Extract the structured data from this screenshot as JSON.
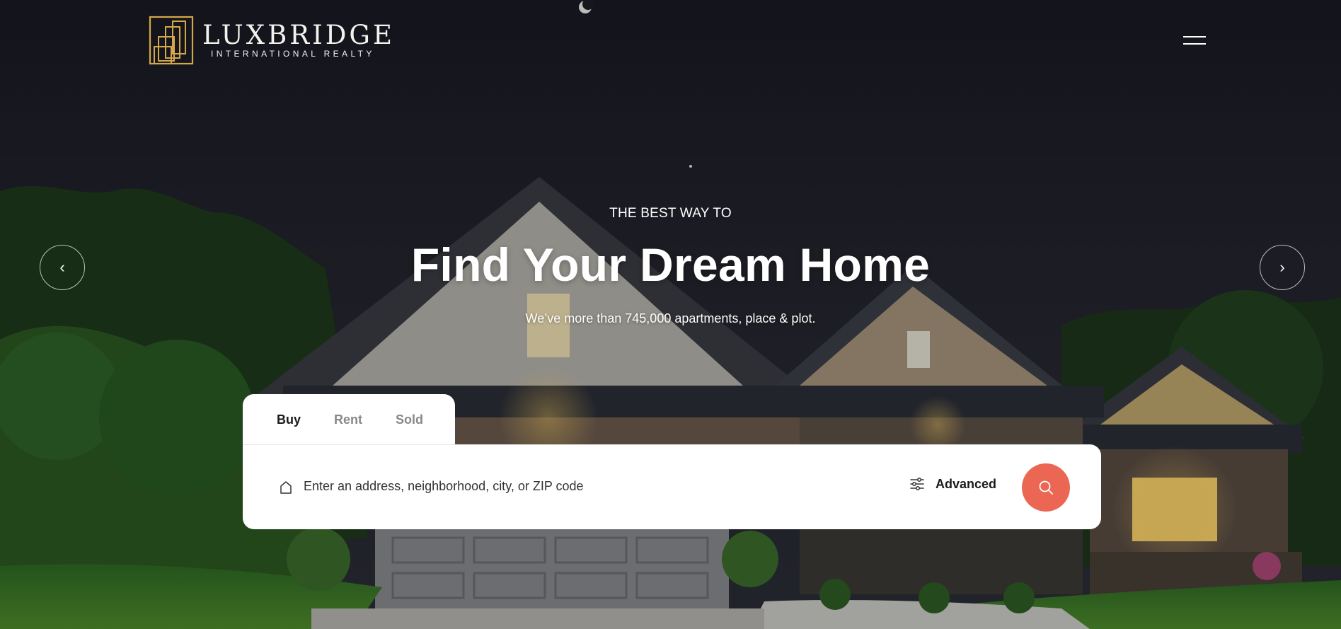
{
  "brand": {
    "name": "LUXBRIDGE",
    "tagline": "INTERNATIONAL REALTY",
    "accent_color": "#d4a74a"
  },
  "nav": {
    "menu_icon": "hamburger-icon"
  },
  "hero": {
    "kicker": "THE BEST WAY TO",
    "headline": "Find Your Dream Home",
    "subline": "We’ve more than 745,000 apartments, place & plot.",
    "prev_icon": "‹",
    "next_icon": "›"
  },
  "search": {
    "tabs": [
      {
        "label": "Buy",
        "active": true
      },
      {
        "label": "Rent",
        "active": false
      },
      {
        "label": "Sold",
        "active": false
      }
    ],
    "placeholder": "Enter an address, neighborhood, city, or ZIP code",
    "advanced_label": "Advanced",
    "button_color": "#eb6753"
  }
}
